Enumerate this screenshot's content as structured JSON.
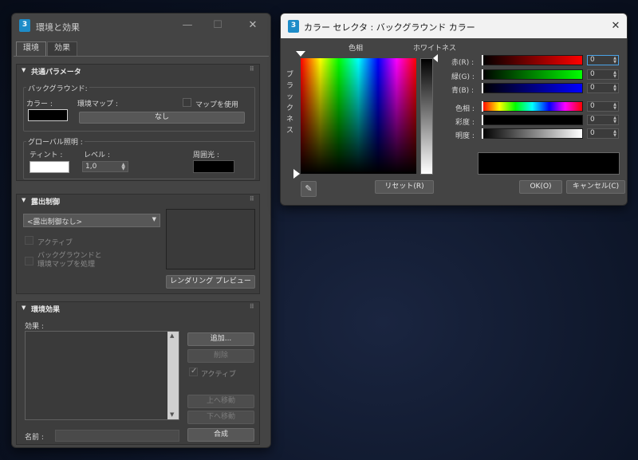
{
  "env": {
    "title": "環境と効果",
    "tabs": [
      "環境",
      "効果"
    ],
    "common": {
      "header": "共通パラメータ",
      "background_group": "バックグラウンド:",
      "color_label": "カラー :",
      "envmap_label": "環境マップ :",
      "use_map_label": "マップを使用",
      "none_button": "なし",
      "global_light_group": "グローバル照明 :",
      "tint_label": "ティント :",
      "level_label": "レベル :",
      "level_value": "1,0",
      "ambient_label": "周囲光 :",
      "bg_color": "#000000",
      "tint_color": "#ffffff",
      "ambient_color": "#000000"
    },
    "exposure": {
      "header": "露出制御",
      "dropdown_value": "<露出制御なし>",
      "active_label": "アクティブ",
      "process_bg_label": "バックグラウンドと\n環境マップを処理",
      "render_preview_button": "レンダリング プレビュー"
    },
    "atmos": {
      "header": "環境効果",
      "effects_label": "効果 :",
      "add_button": "追加...",
      "delete_button": "削除",
      "active_label": "アクティブ",
      "move_up_button": "上へ移動",
      "move_down_button": "下へ移動",
      "name_label": "名前 :",
      "merge_button": "合成"
    }
  },
  "picker": {
    "title": "カラー セレクタ : バックグラウンド カラー",
    "hue_label": "色相",
    "whiteness_label": "ホワイトネス",
    "blackness_label": "ブラックネス",
    "reset_button": "リセット(R)",
    "ok_button": "OK(O)",
    "cancel_button": "キャンセル(C)",
    "rows": [
      {
        "label": "赤(R) :",
        "value": "0"
      },
      {
        "label": "緑(G) :",
        "value": "0"
      },
      {
        "label": "青(B) :",
        "value": "0"
      },
      {
        "label": "色相 :",
        "value": "0"
      },
      {
        "label": "彩度 :",
        "value": "0"
      },
      {
        "label": "明度 :",
        "value": "0"
      }
    ],
    "current_color": "#000000",
    "original_color": "#000000"
  }
}
